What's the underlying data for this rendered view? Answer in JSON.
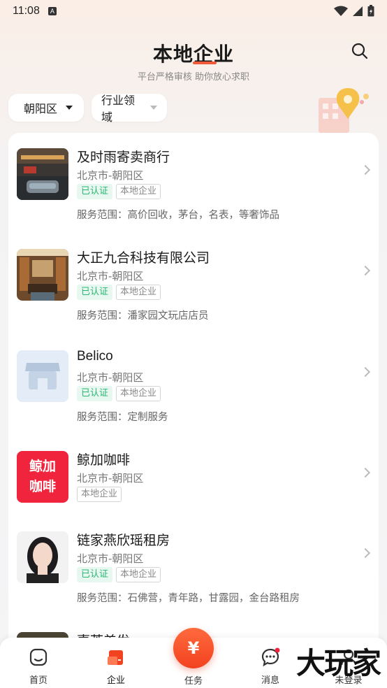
{
  "status_bar": {
    "time": "11:08",
    "a_label": "A"
  },
  "header": {
    "title": "本地企业",
    "subtitle": "平台严格审核 助你放心求职"
  },
  "filters": {
    "district": "朝阳区",
    "industry": "行业领域"
  },
  "list": [
    {
      "name": "及时雨寄卖商行",
      "address": "北京市-朝阳区",
      "verified": "已认证",
      "local": "本地企业",
      "scope": "服务范围：高价回收，茅台，名表，等奢饰品"
    },
    {
      "name": "大正九合科技有限公司",
      "address": "北京市-朝阳区",
      "verified": "已认证",
      "local": "本地企业",
      "scope": "服务范围：潘家园文玩店店员"
    },
    {
      "name": "Belico",
      "address": "北京市-朝阳区",
      "verified": "已认证",
      "local": "本地企业",
      "scope": "服务范围：定制服务"
    },
    {
      "name": "鲸加咖啡",
      "address": "北京市-朝阳区",
      "local": "本地企业",
      "logo_line1": "鲸加",
      "logo_line2": "咖啡"
    },
    {
      "name": "链家燕欣瑶租房",
      "address": "北京市-朝阳区",
      "verified": "已认证",
      "local": "本地企业",
      "scope": "服务范围：石佛营，青年路，甘露园，金台路租房"
    }
  ],
  "partial_item": {
    "name": "壹荟美发"
  },
  "tabbar": {
    "home": "首页",
    "company": "企业",
    "task": "任务",
    "task_symbol": "¥",
    "message": "消息",
    "profile": "未登录"
  },
  "watermark": "大玩家",
  "colors": {
    "accent": "#f2421f",
    "verified_green": "#2bb673",
    "logo_red": "#f0243d"
  }
}
